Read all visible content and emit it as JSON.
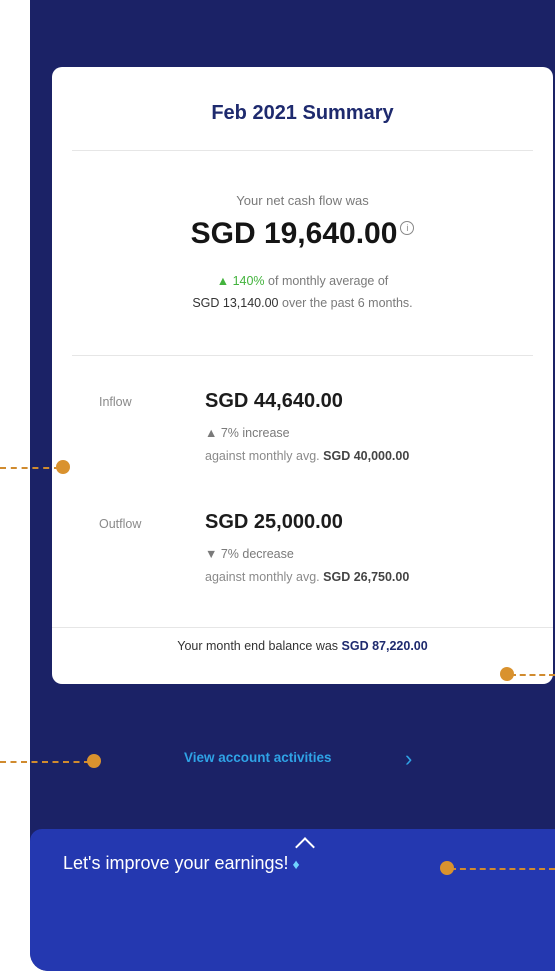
{
  "summary": {
    "title": "Feb 2021 Summary",
    "net_label": "Your net cash flow was",
    "net_amount": "SGD 19,640.00",
    "info_symbol": "i",
    "compare_arrow": "▲",
    "compare_pct": "140%",
    "compare_text1": "of monthly average of",
    "compare_amount": "SGD 13,140.00",
    "compare_text2": "over the past 6 months."
  },
  "inflow": {
    "label": "Inflow",
    "amount": "SGD 44,640.00",
    "change": "▲ 7% increase",
    "avg_prefix": "against monthly avg.",
    "avg_amount": "SGD 40,000.00"
  },
  "outflow": {
    "label": "Outflow",
    "amount": "SGD 25,000.00",
    "change": "▼ 7% decrease",
    "avg_prefix": "against monthly avg.",
    "avg_amount": "SGD 26,750.00"
  },
  "balance": {
    "prefix": "Your month end balance was",
    "amount": "SGD 87,220.00"
  },
  "actions": {
    "view_activities": "View account activities",
    "chevron": "›"
  },
  "promo": {
    "text": "Let's improve your earnings!",
    "gem": "♦"
  },
  "colors": {
    "background": "#1b2266",
    "card": "#ffffff",
    "title": "#1e2a6e",
    "positive": "#43b33d",
    "link": "#2fa3e6",
    "panel": "#2438b0",
    "annotation": "#d9922e"
  },
  "icons": [
    "info-icon",
    "chevron-right-icon",
    "chevron-up-icon",
    "diamond-icon"
  ]
}
